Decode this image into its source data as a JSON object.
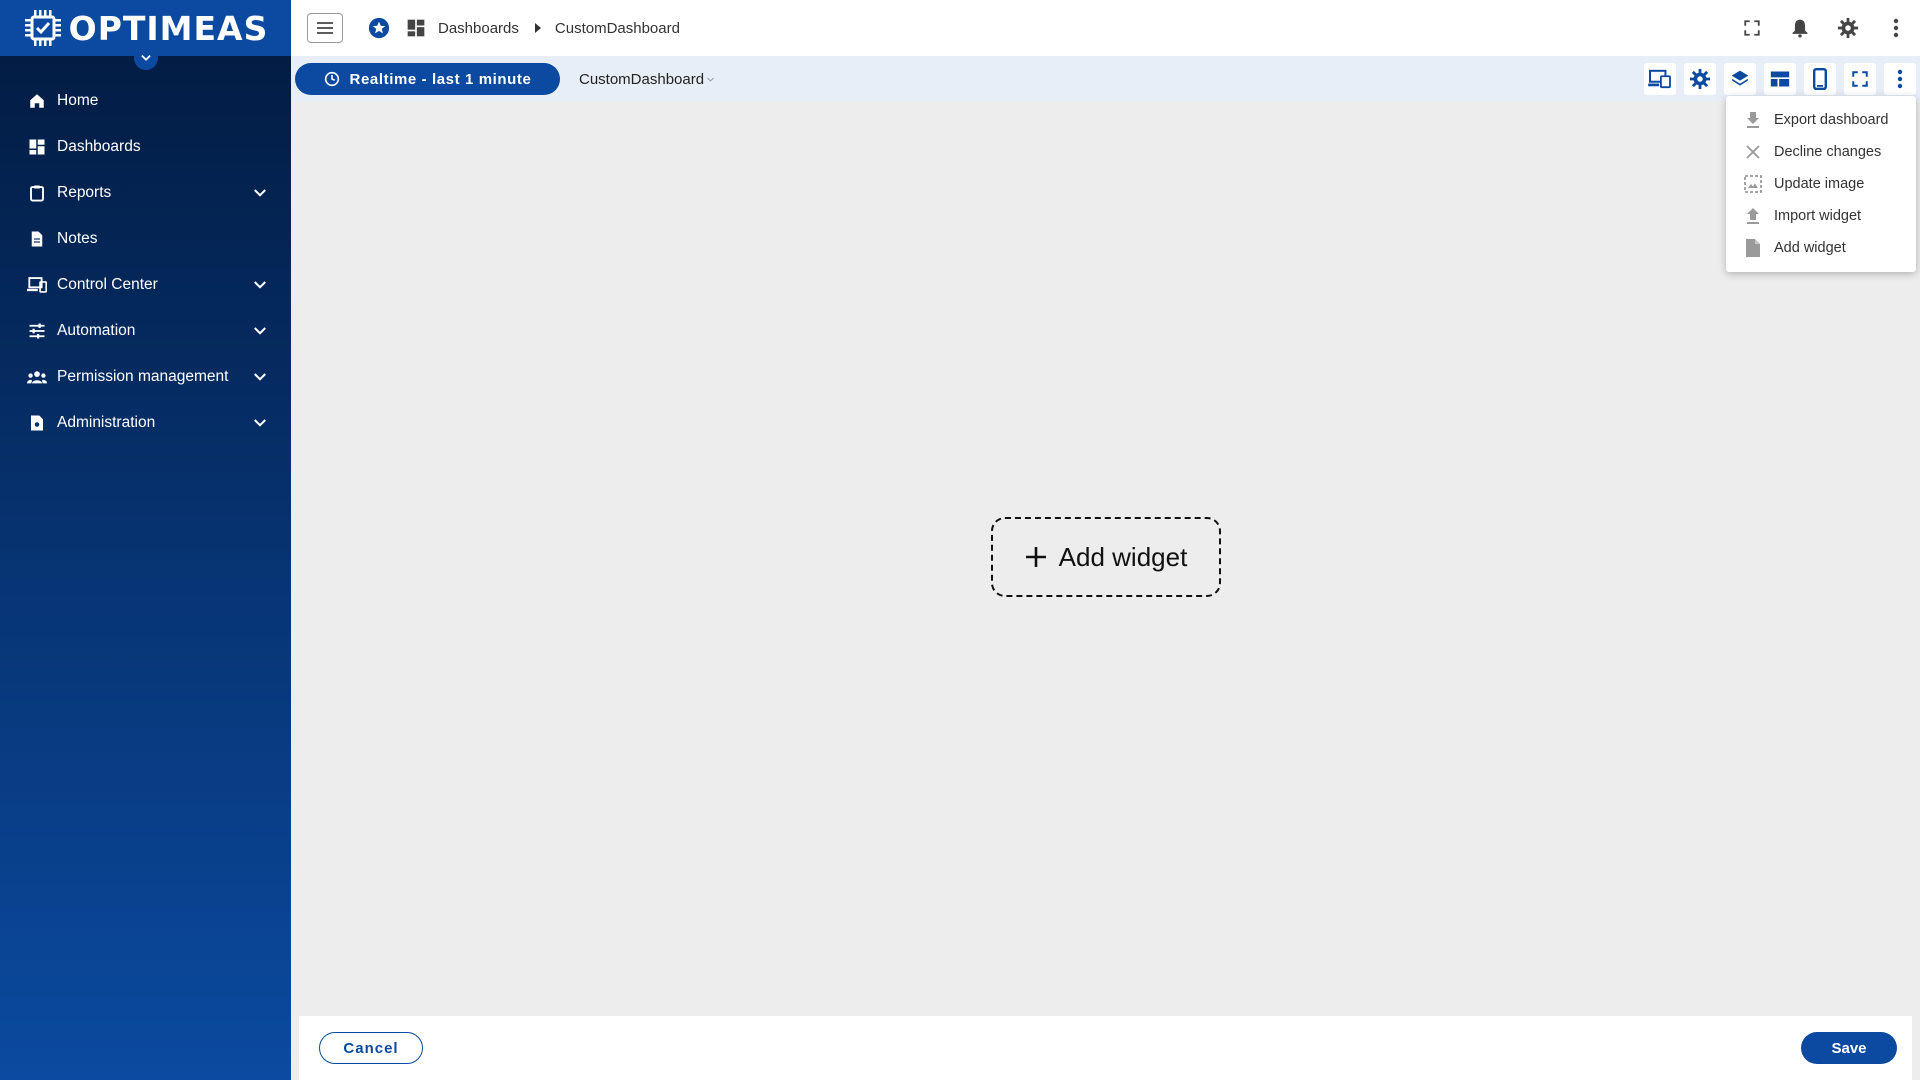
{
  "brand": {
    "name": "OPTIMEAS"
  },
  "sidebar": {
    "items": [
      {
        "label": "Home",
        "icon": "home-icon",
        "expandable": false
      },
      {
        "label": "Dashboards",
        "icon": "dashboard-icon",
        "expandable": false
      },
      {
        "label": "Reports",
        "icon": "clipboard-icon",
        "expandable": true
      },
      {
        "label": "Notes",
        "icon": "note-icon",
        "expandable": false
      },
      {
        "label": "Control Center",
        "icon": "devices-icon",
        "expandable": true
      },
      {
        "label": "Automation",
        "icon": "tune-icon",
        "expandable": true
      },
      {
        "label": "Permission management",
        "icon": "group-icon",
        "expandable": true
      },
      {
        "label": "Administration",
        "icon": "admin-icon",
        "expandable": true
      }
    ]
  },
  "header": {
    "breadcrumb": [
      "Dashboards",
      "CustomDashboard"
    ]
  },
  "toolbar": {
    "realtime_label": "Realtime - last 1 minute",
    "dashboard_name": "CustomDashboard"
  },
  "canvas": {
    "add_widget_label": "Add widget"
  },
  "menu": {
    "items": [
      {
        "label": "Export dashboard",
        "icon": "download-icon"
      },
      {
        "label": "Decline changes",
        "icon": "close-icon"
      },
      {
        "label": "Update image",
        "icon": "image-icon"
      },
      {
        "label": "Import widget",
        "icon": "upload-icon"
      },
      {
        "label": "Add widget",
        "icon": "file-icon"
      }
    ]
  },
  "footer": {
    "cancel_label": "Cancel",
    "save_label": "Save"
  },
  "colors": {
    "primary": "#0b4aa0",
    "sidebar_dark": "#021a3f",
    "canvas_bg": "#ededed"
  }
}
